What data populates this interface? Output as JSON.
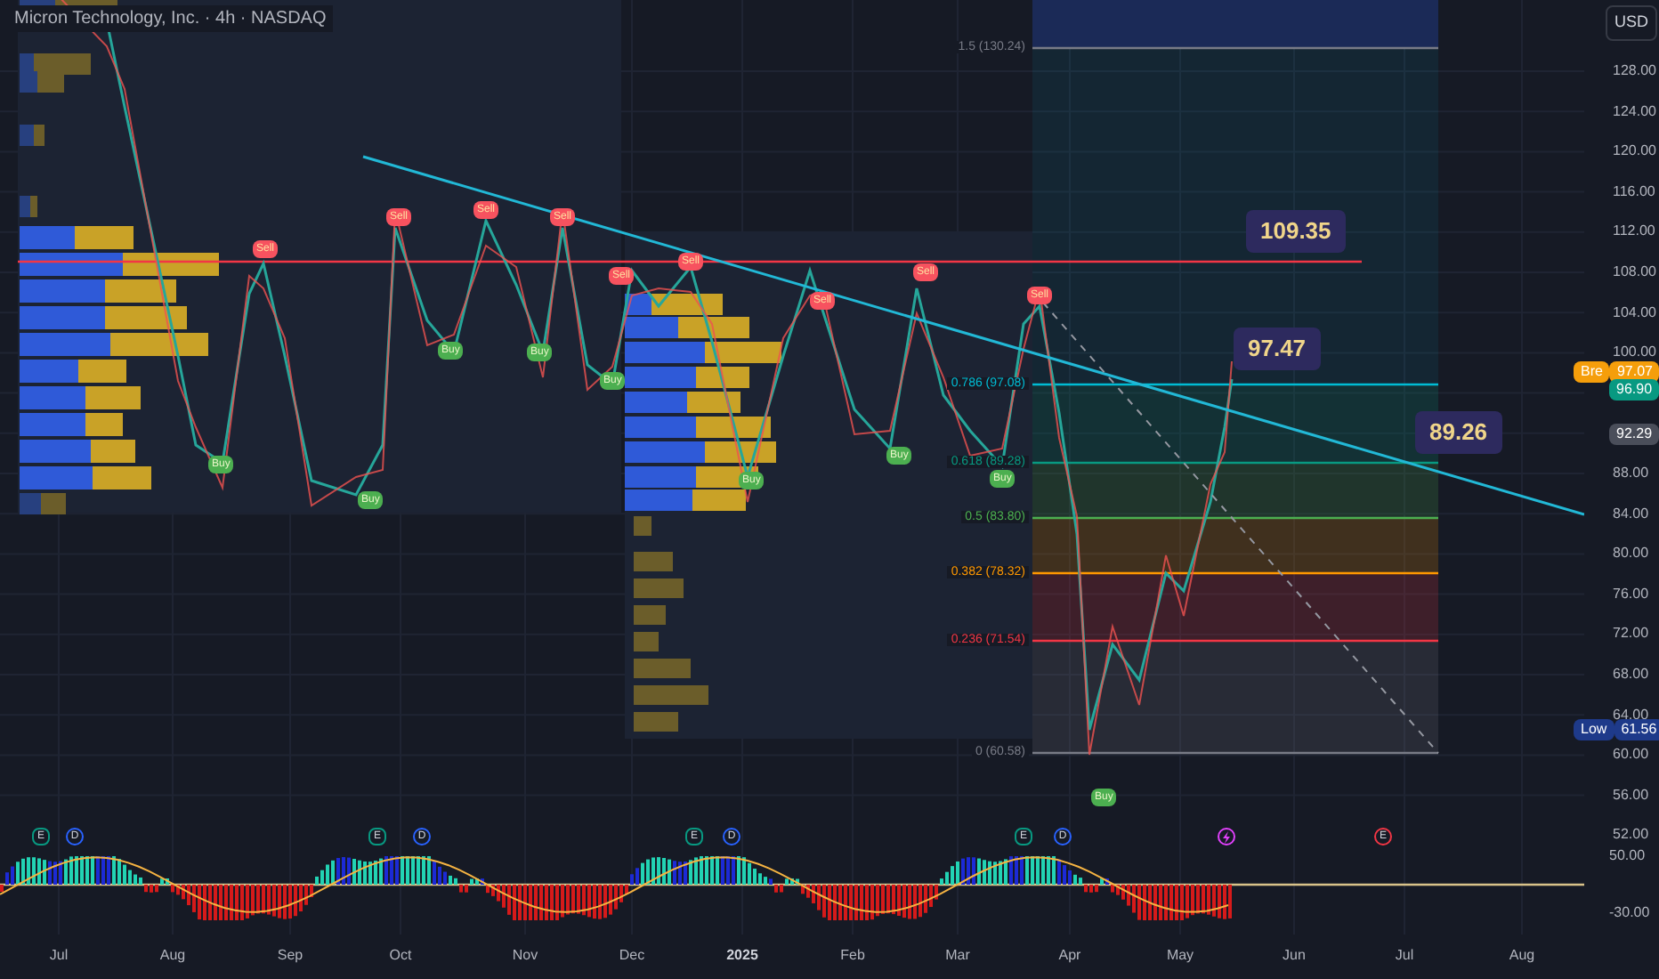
{
  "title": "Micron Technology, Inc. · 4h · NASDAQ",
  "currency": "USD",
  "price_axis": [
    "128.00",
    "124.00",
    "120.00",
    "116.00",
    "112.00",
    "108.00",
    "104.00",
    "100.00",
    "88.00",
    "84.00",
    "80.00",
    "76.00",
    "72.00",
    "68.00",
    "64.00",
    "60.00",
    "56.00",
    "52.00"
  ],
  "price_tags": [
    {
      "label": "Bre",
      "value": "97.07",
      "color": "#f59e0b"
    },
    {
      "value": "96.90",
      "color": "#089981"
    },
    {
      "value": "92.29",
      "color": "#4a4e5a"
    },
    {
      "label": "Low",
      "value": "61.56",
      "color": "#1e3a8a"
    }
  ],
  "fib_levels": [
    {
      "label": "1.5 (130.24)",
      "color": "#787b86"
    },
    {
      "label": "0.786 (97.08)",
      "color": "#00bcd4"
    },
    {
      "label": "0.618 (89.28)",
      "color": "#089981"
    },
    {
      "label": "0.5 (83.80)",
      "color": "#4caf50"
    },
    {
      "label": "0.382 (78.32)",
      "color": "#ff9800"
    },
    {
      "label": "0.236 (71.54)",
      "color": "#f23645"
    },
    {
      "label": "0 (60.58)",
      "color": "#787b86"
    }
  ],
  "callouts": [
    "109.35",
    "97.47",
    "89.26"
  ],
  "signals": [
    {
      "kind": "sell",
      "label": "Sell"
    },
    {
      "kind": "sell",
      "label": "Sell"
    },
    {
      "kind": "sell",
      "label": "Sell"
    },
    {
      "kind": "sell",
      "label": "Sell"
    },
    {
      "kind": "sell",
      "label": "Sell"
    },
    {
      "kind": "sell",
      "label": "Sell"
    },
    {
      "kind": "sell",
      "label": "Sell"
    },
    {
      "kind": "sell",
      "label": "Sell"
    },
    {
      "kind": "sell",
      "label": "Sell"
    },
    {
      "kind": "buy",
      "label": "Buy"
    },
    {
      "kind": "buy",
      "label": "Buy"
    },
    {
      "kind": "buy",
      "label": "Buy"
    },
    {
      "kind": "buy",
      "label": "Buy"
    },
    {
      "kind": "buy",
      "label": "Buy"
    },
    {
      "kind": "buy",
      "label": "Buy"
    },
    {
      "kind": "buy",
      "label": "Buy"
    },
    {
      "kind": "buy",
      "label": "Buy"
    },
    {
      "kind": "buy",
      "label": "Buy"
    }
  ],
  "events": [
    {
      "kind": "letter",
      "label": "E",
      "color": "#089981"
    },
    {
      "kind": "letter",
      "label": "D",
      "color": "#2962ff"
    },
    {
      "kind": "letter",
      "label": "E",
      "color": "#089981"
    },
    {
      "kind": "letter",
      "label": "D",
      "color": "#2962ff"
    },
    {
      "kind": "letter",
      "label": "E",
      "color": "#089981"
    },
    {
      "kind": "letter",
      "label": "D",
      "color": "#2962ff"
    },
    {
      "kind": "letter",
      "label": "E",
      "color": "#089981"
    },
    {
      "kind": "letter",
      "label": "D",
      "color": "#2962ff"
    },
    {
      "kind": "flash",
      "color": "#e040fb"
    },
    {
      "kind": "letter",
      "label": "E",
      "color": "#f23645"
    }
  ],
  "oscillator_axis": [
    "50.00",
    "-30.00"
  ],
  "time_axis": [
    {
      "kind": "month",
      "label": "Jul"
    },
    {
      "kind": "month",
      "label": "Aug"
    },
    {
      "kind": "month",
      "label": "Sep"
    },
    {
      "kind": "month",
      "label": "Oct"
    },
    {
      "kind": "month",
      "label": "Nov"
    },
    {
      "kind": "month",
      "label": "Dec"
    },
    {
      "kind": "year",
      "label": "2025"
    },
    {
      "kind": "month",
      "label": "Feb"
    },
    {
      "kind": "month",
      "label": "Mar"
    },
    {
      "kind": "month",
      "label": "Apr"
    },
    {
      "kind": "month",
      "label": "May"
    },
    {
      "kind": "month",
      "label": "Jun"
    },
    {
      "kind": "month",
      "label": "Jul"
    },
    {
      "kind": "month",
      "label": "Aug"
    }
  ]
}
